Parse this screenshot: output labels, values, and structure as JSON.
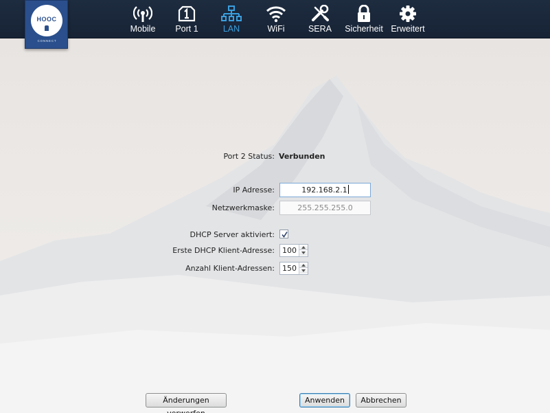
{
  "logo": {
    "text": "HOOC",
    "subtext": "CONNECT"
  },
  "nav": [
    {
      "label": "Mobile",
      "icon": "antenna-icon",
      "active": false
    },
    {
      "label": "Port 1",
      "icon": "port-1-icon",
      "active": false
    },
    {
      "label": "LAN",
      "icon": "network-tree-icon",
      "active": true
    },
    {
      "label": "WiFi",
      "icon": "wifi-icon",
      "active": false
    },
    {
      "label": "SERA",
      "icon": "tools-icon",
      "active": false
    },
    {
      "label": "Sicherheit",
      "icon": "lock-icon",
      "active": false
    },
    {
      "label": "Erweitert",
      "icon": "gear-icon",
      "active": false
    }
  ],
  "colors": {
    "nav_bg": "#1e2c40",
    "active": "#3aa0e0",
    "logo": "#2a4f8c"
  },
  "form": {
    "port_status": {
      "label": "Port 2 Status:",
      "value": "Verbunden"
    },
    "ip": {
      "label": "IP Adresse:",
      "value": "192.168.2.1"
    },
    "netmask": {
      "label": "Netzwerkmaske:",
      "value": "255.255.255.0"
    },
    "dhcp": {
      "label": "DHCP Server aktiviert:",
      "checked": true
    },
    "first_client": {
      "label": "Erste DHCP Klient-Adresse:",
      "value": "100"
    },
    "client_count": {
      "label": "Anzahl Klient-Adressen:",
      "value": "150"
    }
  },
  "buttons": {
    "discard": "Änderungen verwerfen",
    "apply": "Anwenden",
    "cancel": "Abbrechen"
  }
}
